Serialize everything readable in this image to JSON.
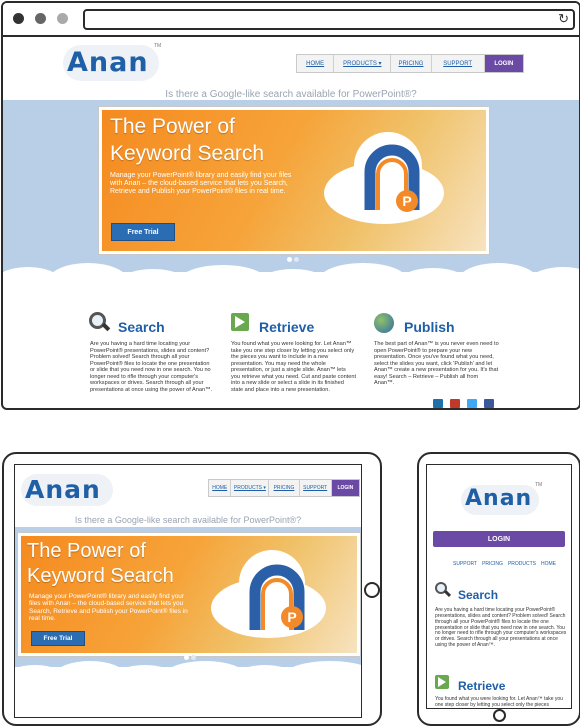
{
  "app": {
    "logo_text": "Anan",
    "trademark": "TM"
  },
  "nav": {
    "home": "HOME",
    "products": "PRODUCTS ▾",
    "pricing": "PRICING",
    "support": "SUPPORT",
    "login": "LOGIN"
  },
  "tagline": "Is there a Google-like search available for PowerPoint®?",
  "hero": {
    "title_line1": "The Power of",
    "title_line2": "Keyword Search",
    "description": "Manage your PowerPoint® library and easily find your files with Anan – the cloud-based service that lets you Search, Retrieve and Publish your PowerPoint® files in real time.",
    "cta": "Free Trial",
    "logo_letter": "P"
  },
  "features": [
    {
      "title": "Search",
      "icon": "magnifier-icon",
      "text": "Are you having a hard time locating your PowerPoint® presentations, slides and content? Problem solved! Search through all your PowerPoint® files to locate the one presentation or slide that you need now in one search. You no longer need to rifle through your computer's workspaces or drives. Search through all your presentations at once using the power of Anan™."
    },
    {
      "title": "Retrieve",
      "icon": "retrieve-icon",
      "text": "You found what you were looking for. Let Anan™ take you one step closer by letting you select only the pieces you want to include in a new presentation. You may need the whole presentation, or just a single slide. Anan™ lets you retrieve what you need. Cut and paste content into a new slide or select a slide in its finished state and place into a new presentation."
    },
    {
      "title": "Publish",
      "icon": "globe-icon",
      "text": "The best part of Anan™ is you never even need to open PowerPoint® to prepare your new presentation. Once you've found what you need, select the slides you want, click 'Publish' and let Anan™ create a new presentation for you. It's that easy! Search – Retrieve – Publish all from Anan™."
    }
  ],
  "phone": {
    "login": "LOGIN",
    "links": [
      "SUPPORT",
      "PRICING",
      "PRODUCTS",
      "HOME"
    ],
    "search_title": "Search",
    "search_text": "Are you having a hard time locating your PowerPoint® presentations, slides and content? Problem solved! Search through all your PowerPoint® files to locate the one presentation or slide that you need now in one search. You no longer need to rifle through your computer's workspaces or drives. Search through all your presentations at once using the power of Anan™.",
    "retrieve_title": "Retrieve",
    "retrieve_text": "You found what you were looking for. Let Anan™ take you one step closer by letting you select only the pieces"
  },
  "colors": {
    "brand_blue": "#1f5fa8",
    "login_purple": "#6a4aa5",
    "hero_orange": "#f58a1f",
    "band_blue": "#b9cfe8",
    "cta_blue": "#2b6db3"
  }
}
